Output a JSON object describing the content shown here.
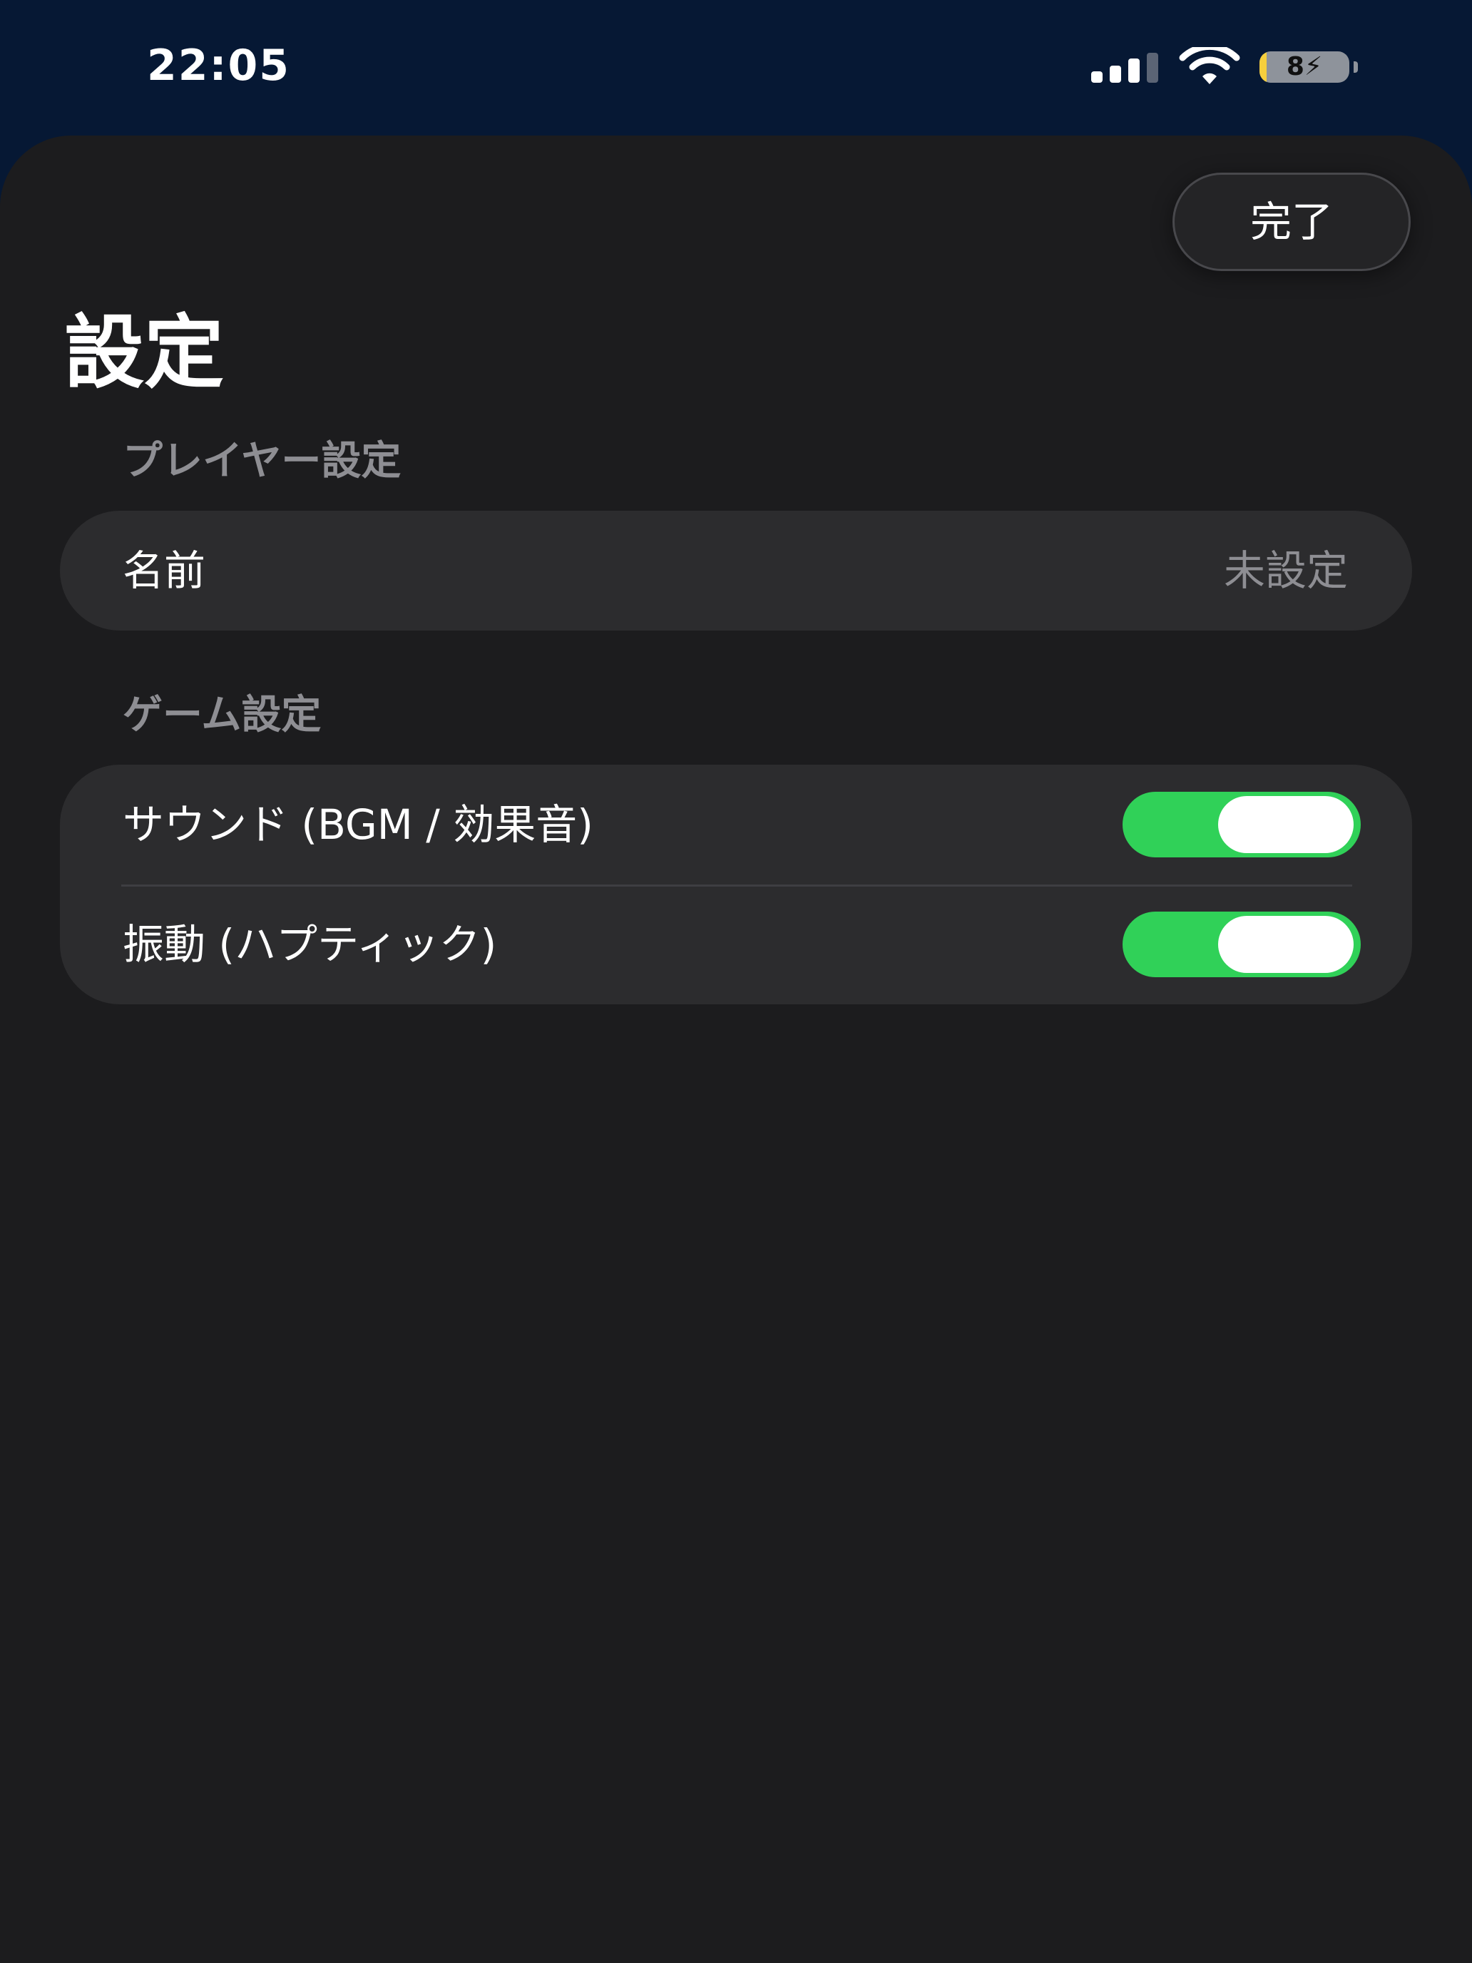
{
  "status_bar": {
    "time": "22:05",
    "battery_level": "8",
    "battery_fraction": 0.08,
    "battery_color": "#f6cf3d",
    "signal_bars_active": 3,
    "signal_bars_total": 4,
    "icons": [
      "signal-icon",
      "wifi-icon",
      "battery-charging-icon"
    ]
  },
  "header": {
    "done_label": "完了",
    "title": "設定"
  },
  "sections": {
    "player": {
      "header": "プレイヤー設定",
      "name_label": "名前",
      "name_value": "未設定"
    },
    "game": {
      "header": "ゲーム設定",
      "sound_label": "サウンド (BGM / 効果音)",
      "sound_enabled": true,
      "vibration_label": "振動 (ハプティック)",
      "vibration_enabled": true
    }
  },
  "colors": {
    "background_top": "#061834",
    "sheet": "#1c1c1e",
    "group": "#2c2c2e",
    "toggle_on": "#30d158",
    "secondary_text": "#8e8e93"
  }
}
